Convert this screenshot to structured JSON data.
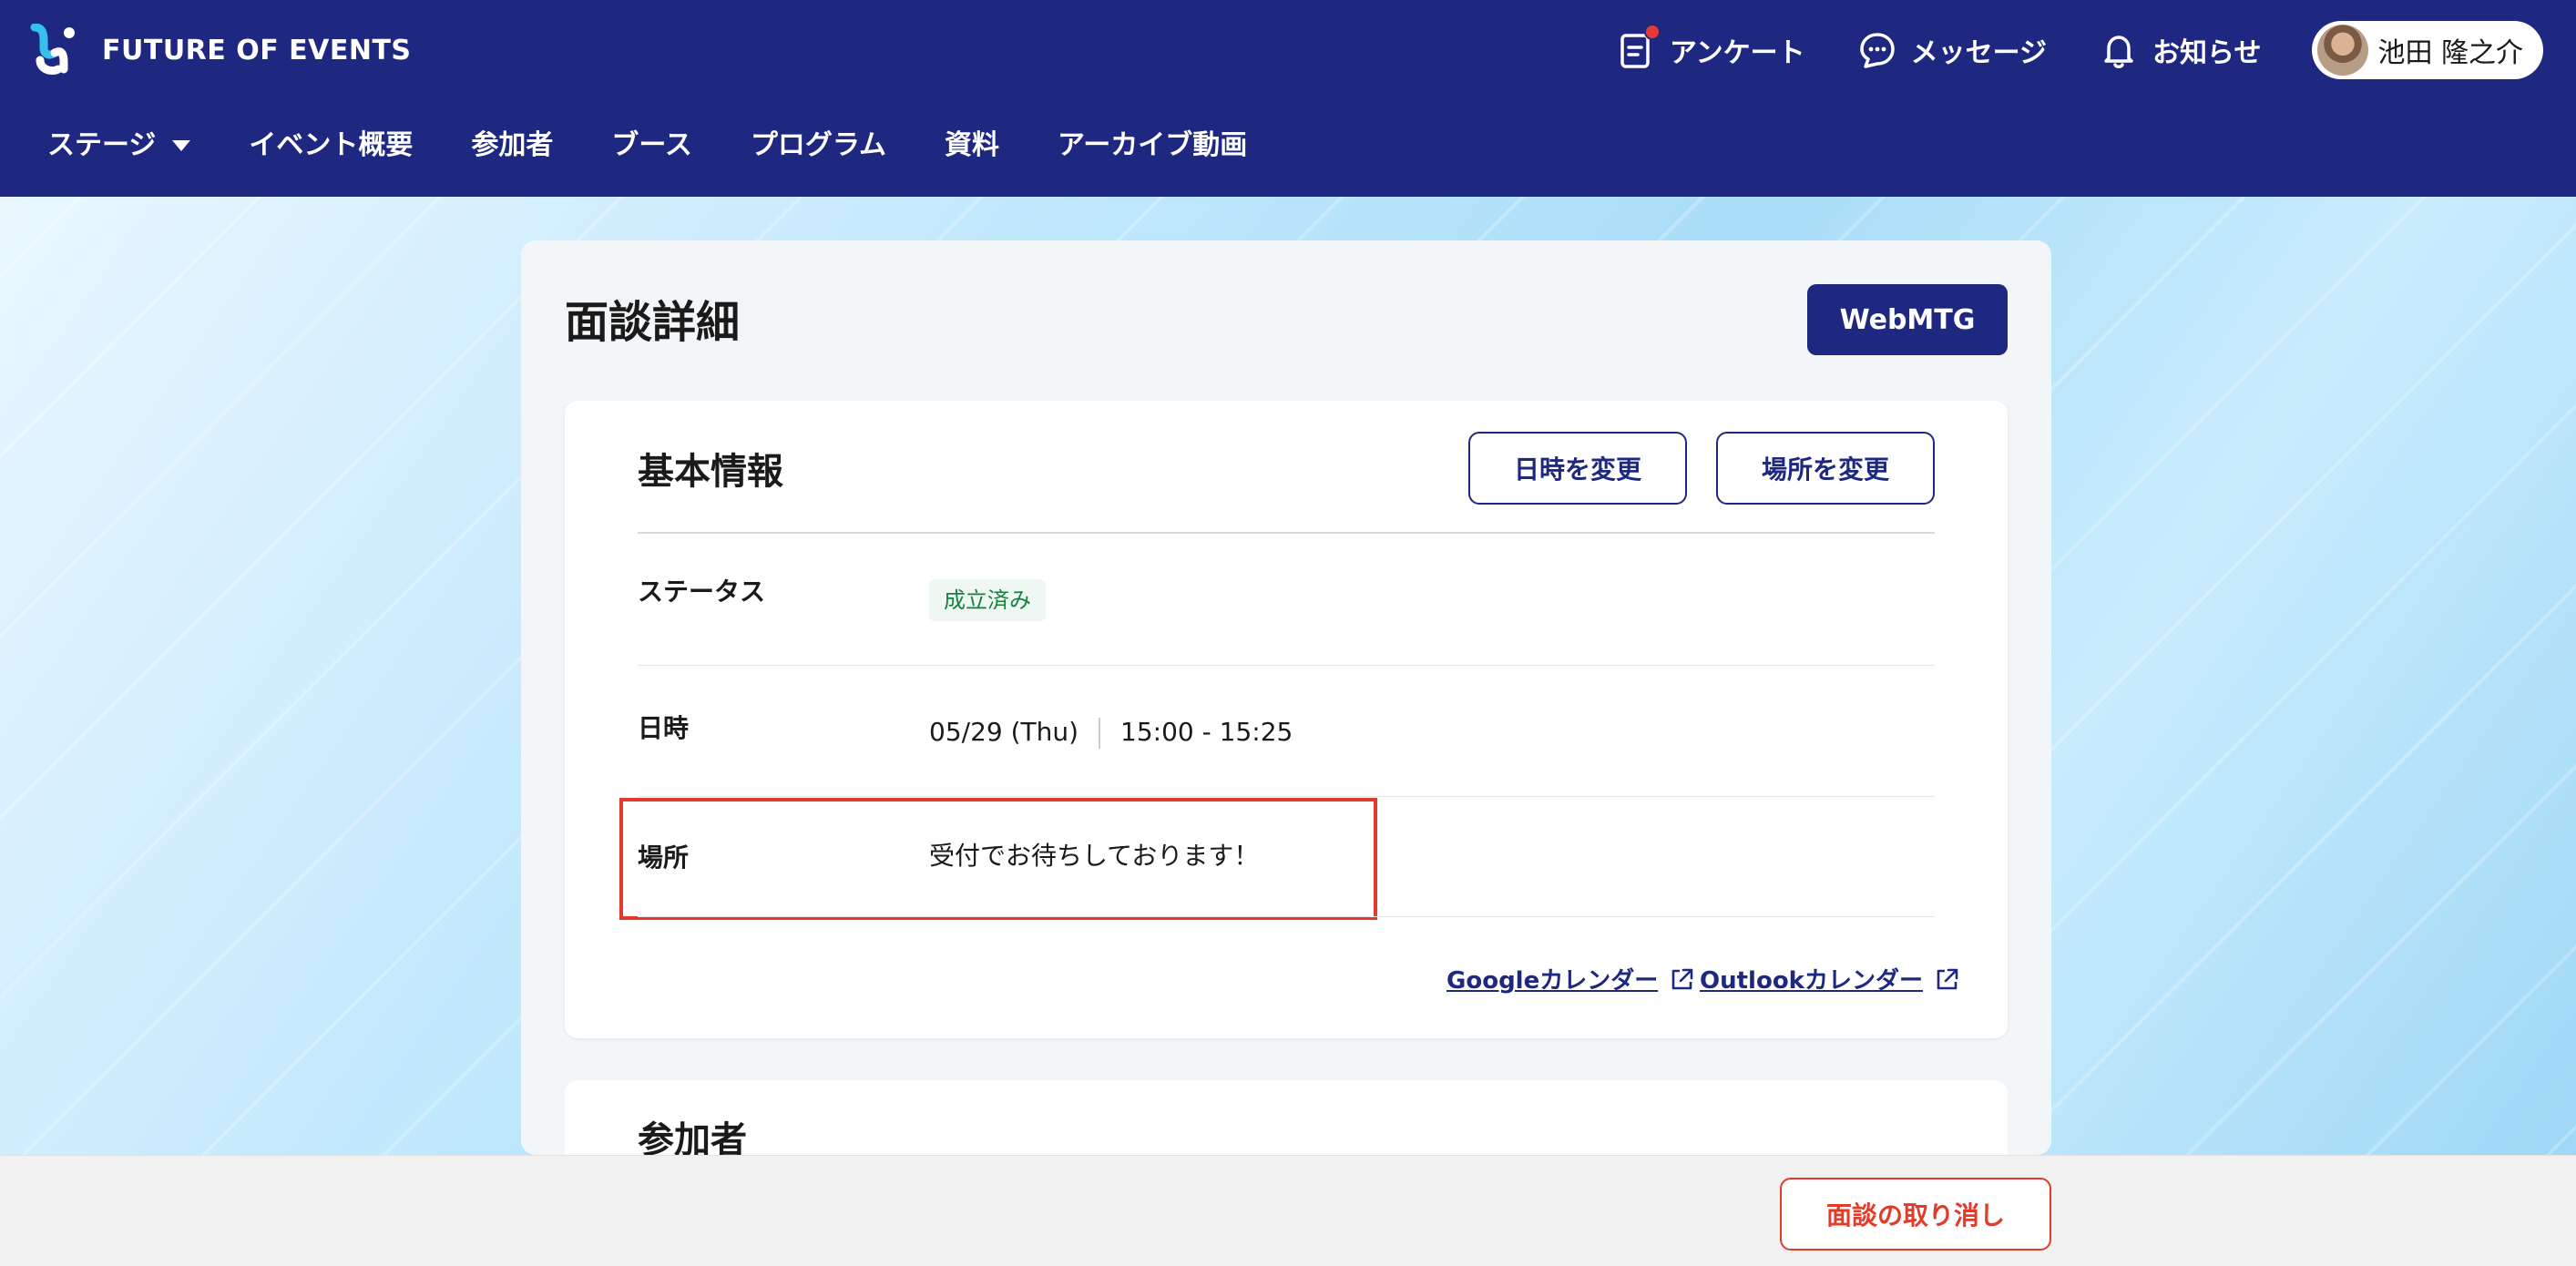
{
  "header": {
    "brand": "FUTURE OF EVENTS",
    "actions": [
      {
        "label": "アンケート",
        "icon": "survey-icon",
        "has_notification_dot": true
      },
      {
        "label": "メッセージ",
        "icon": "chat-bubble-icon"
      },
      {
        "label": "お知らせ",
        "icon": "bell-icon"
      }
    ],
    "user": {
      "name": "池田 隆之介"
    }
  },
  "nav": {
    "items": [
      {
        "label": "ステージ",
        "has_dropdown": true
      },
      {
        "label": "イベント概要"
      },
      {
        "label": "参加者"
      },
      {
        "label": "ブース"
      },
      {
        "label": "プログラム"
      },
      {
        "label": "資料"
      },
      {
        "label": "アーカイブ動画"
      }
    ]
  },
  "page": {
    "title": "面談詳細",
    "primary_button": "WebMTG"
  },
  "basic_info": {
    "title": "基本情報",
    "change_datetime_button": "日時を変更",
    "change_location_button": "場所を変更",
    "rows": {
      "status": {
        "label": "ステータス",
        "value": "成立済み"
      },
      "datetime": {
        "label": "日時",
        "date": "05/29 (Thu)",
        "time": "15:00 - 15:25"
      },
      "location": {
        "label": "場所",
        "value": "受付でお待ちしております！"
      }
    },
    "links": {
      "google": "Googleカレンダー",
      "outlook": "Outlookカレンダー"
    }
  },
  "participants": {
    "title": "参加者"
  },
  "footer": {
    "cancel_button": "面談の取り消し"
  },
  "colors": {
    "header_bg": "#1e2880",
    "accent": "#1e2880",
    "status_green": "#17803d",
    "danger": "#e23b2a"
  }
}
